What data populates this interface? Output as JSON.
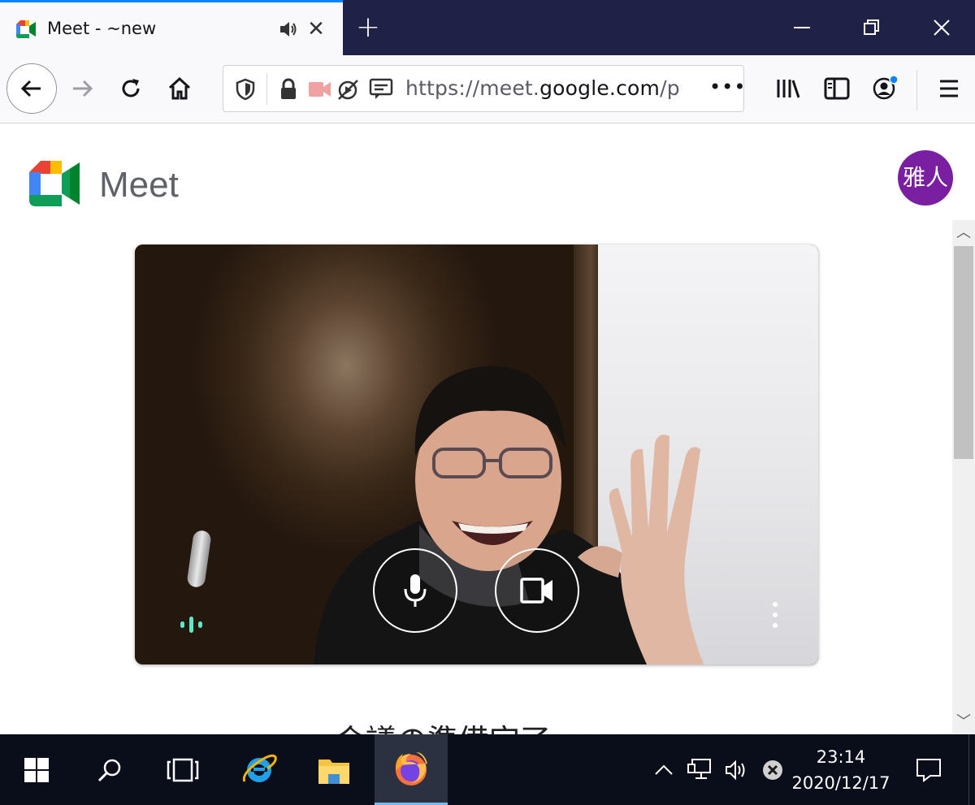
{
  "browser": {
    "tab": {
      "title": "Meet - ~new",
      "favicon": "google-meet-icon",
      "audio_icon": "speaker-icon",
      "close_icon": "close-icon"
    },
    "new_tab_icon": "plus-icon",
    "window_controls": [
      "minimize-icon",
      "restore-icon",
      "close-icon"
    ],
    "toolbar": {
      "buttons": [
        "back-icon",
        "forward-icon",
        "reload-icon",
        "home-icon"
      ],
      "url_prefix": "https://meet.",
      "url_domain": "google.com",
      "url_suffix": "/puc-ct",
      "page_actions_label": "•••",
      "right_buttons": [
        "library-icon",
        "sidebar-icon",
        "account-icon",
        "menu-icon"
      ]
    }
  },
  "page": {
    "app_name": "Meet",
    "avatar_text": "雅人",
    "preview": {
      "mic_state": "on",
      "camera_state": "on",
      "audio_indicator_color": "#5fe8c8"
    },
    "ready_heading": "会議の準備完了"
  },
  "taskbar": {
    "apps": [
      "windows-start-icon",
      "search-icon",
      "task-view-icon",
      "internet-explorer-icon",
      "file-explorer-icon",
      "firefox-icon"
    ],
    "time": "23:14",
    "date": "2020/12/17"
  }
}
